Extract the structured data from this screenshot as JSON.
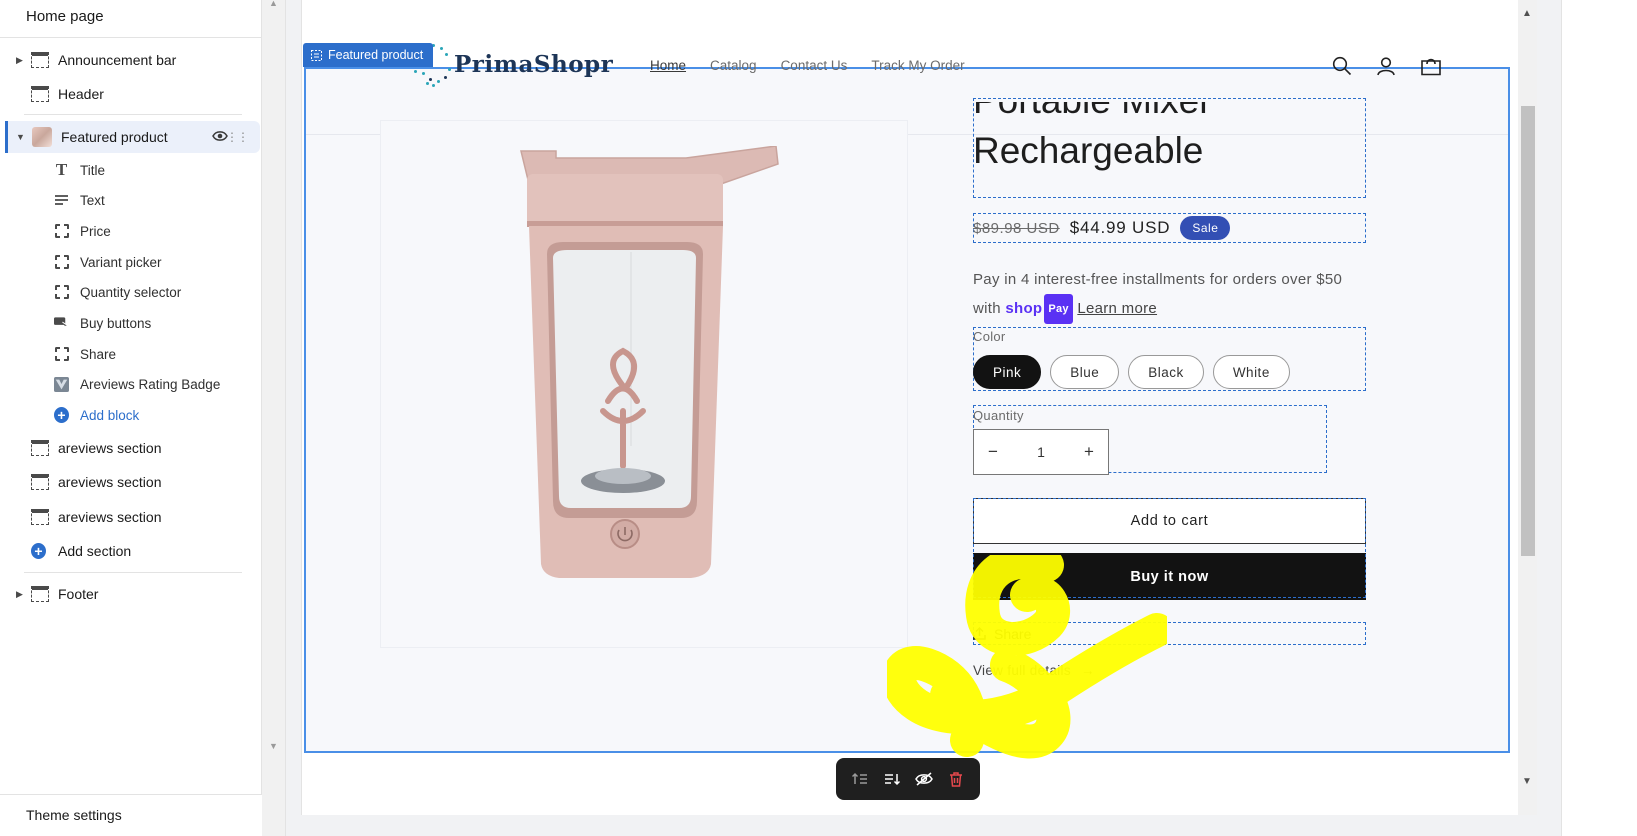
{
  "sidebar": {
    "title": "Home page",
    "sections": {
      "announcement": "Announcement bar",
      "header": "Header",
      "featured": "Featured product",
      "areviews1": "areviews section",
      "areviews2": "areviews section",
      "areviews3": "areviews section",
      "footer": "Footer"
    },
    "blocks": {
      "title": "Title",
      "text": "Text",
      "price": "Price",
      "variant": "Variant picker",
      "quantity": "Quantity selector",
      "buy": "Buy buttons",
      "share": "Share",
      "areviews": "Areviews Rating Badge"
    },
    "add_block": "Add block",
    "add_section": "Add section",
    "theme_settings": "Theme settings"
  },
  "preview": {
    "section_tag": "Featured product",
    "store": {
      "logo": "PrimaShopr",
      "nav": [
        "Home",
        "Catalog",
        "Contact Us",
        "Track My Order"
      ]
    },
    "product": {
      "title": "Portable Mixer\nRechargeable",
      "price_compare": "$89.98 USD",
      "price": "$44.99 USD",
      "sale_badge": "Sale",
      "installments_text": "Pay in 4 interest-free installments for orders over $50",
      "installments_with": "with",
      "shoppay_word": "shop",
      "shoppay_pay": "Pay",
      "learn_more": "Learn more",
      "color_label": "Color",
      "colors": [
        "Pink",
        "Blue",
        "Black",
        "White"
      ],
      "selected_color": "Pink",
      "quantity_label": "Quantity",
      "quantity": "1",
      "add_to_cart": "Add to cart",
      "buy_now": "Buy it now",
      "share": "Share",
      "view_details": "View full details"
    }
  },
  "icons": {
    "toolbar": [
      "move-up-icon",
      "move-down-icon",
      "hide-icon",
      "delete-icon"
    ],
    "header": [
      "search-icon",
      "account-icon",
      "cart-icon"
    ]
  },
  "colors": {
    "accent": "#2c6ecb",
    "sale_badge": "#334fb4",
    "annotation": "#ffff00",
    "delete": "#e5484d"
  }
}
